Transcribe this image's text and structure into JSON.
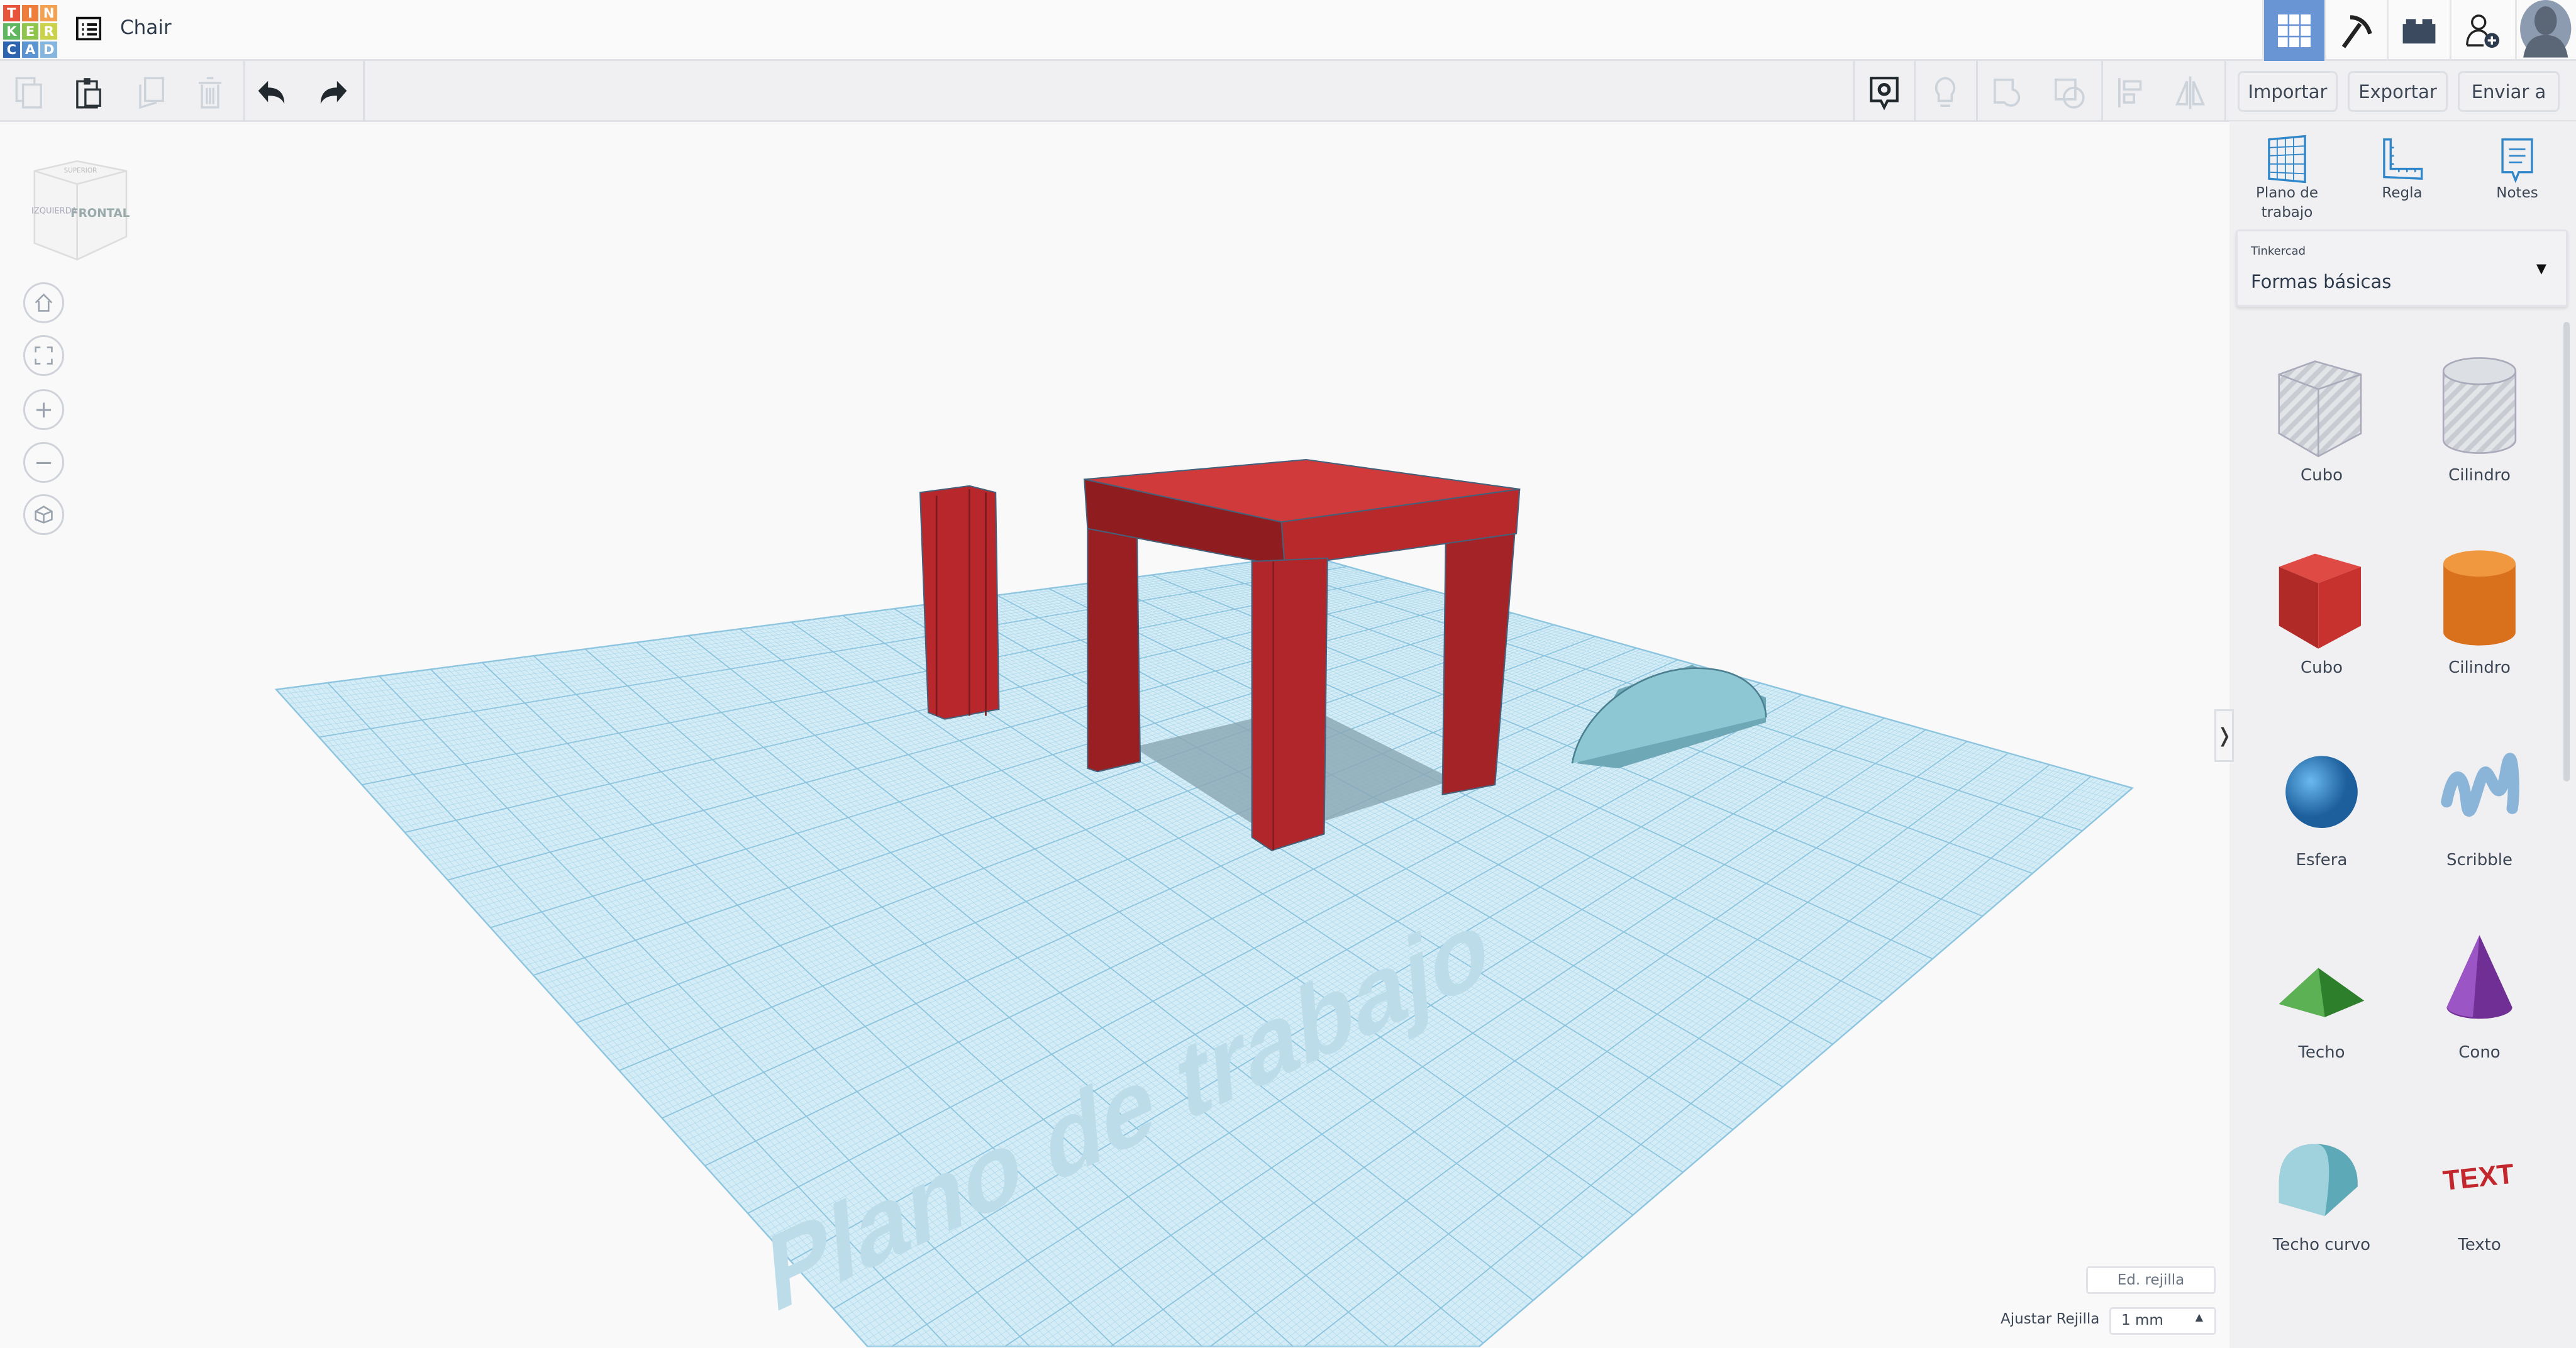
{
  "logo": {
    "letters": [
      "T",
      "I",
      "N",
      "K",
      "E",
      "R",
      "C",
      "A",
      "D"
    ],
    "colors": [
      "#e8543b",
      "#ef7d3c",
      "#f3a254",
      "#5fb85f",
      "#8fc54a",
      "#c9d24a",
      "#2c64b0",
      "#5b94d0",
      "#85b6df"
    ]
  },
  "header": {
    "title": "Chair",
    "accent": "#6a95d4"
  },
  "toolbar": {
    "import_label": "Importar",
    "export_label": "Exportar",
    "send_label": "Enviar a"
  },
  "sidebar": {
    "tools": [
      {
        "label": "Plano de trabajo",
        "icon": "workplane-icon"
      },
      {
        "label": "Regla",
        "icon": "ruler-icon"
      },
      {
        "label": "Notes",
        "icon": "notes-icon"
      }
    ],
    "library": {
      "source": "Tinkercad",
      "selected": "Formas básicas"
    },
    "shapes": [
      {
        "label": "Cubo",
        "kind": "hole-box"
      },
      {
        "label": "Cilindro",
        "kind": "hole-cylinder"
      },
      {
        "label": "Cubo",
        "kind": "box",
        "color": "#d23a36"
      },
      {
        "label": "Cilindro",
        "kind": "cylinder",
        "color": "#e07b24"
      },
      {
        "label": "Esfera",
        "kind": "sphere",
        "color": "#2f86c9"
      },
      {
        "label": "Scribble",
        "kind": "scribble",
        "color": "#8ab4d8"
      },
      {
        "label": "Techo",
        "kind": "roof",
        "color": "#3e9c3a"
      },
      {
        "label": "Cono",
        "kind": "cone",
        "color": "#7a3a9e"
      },
      {
        "label": "Techo curvo",
        "kind": "curved-roof",
        "color": "#7fc0cc"
      },
      {
        "label": "Texto",
        "kind": "text",
        "color": "#c1272d"
      }
    ]
  },
  "viewcube": {
    "front": "FRONTAL",
    "left": "IZQUIERDA",
    "top": "SUPERIOR"
  },
  "workplane": {
    "label": "Plano de trabajo"
  },
  "grid": {
    "edit_label": "Ed. rejilla",
    "snap_label": "Ajustar Rejilla",
    "snap_value": "1 mm"
  }
}
